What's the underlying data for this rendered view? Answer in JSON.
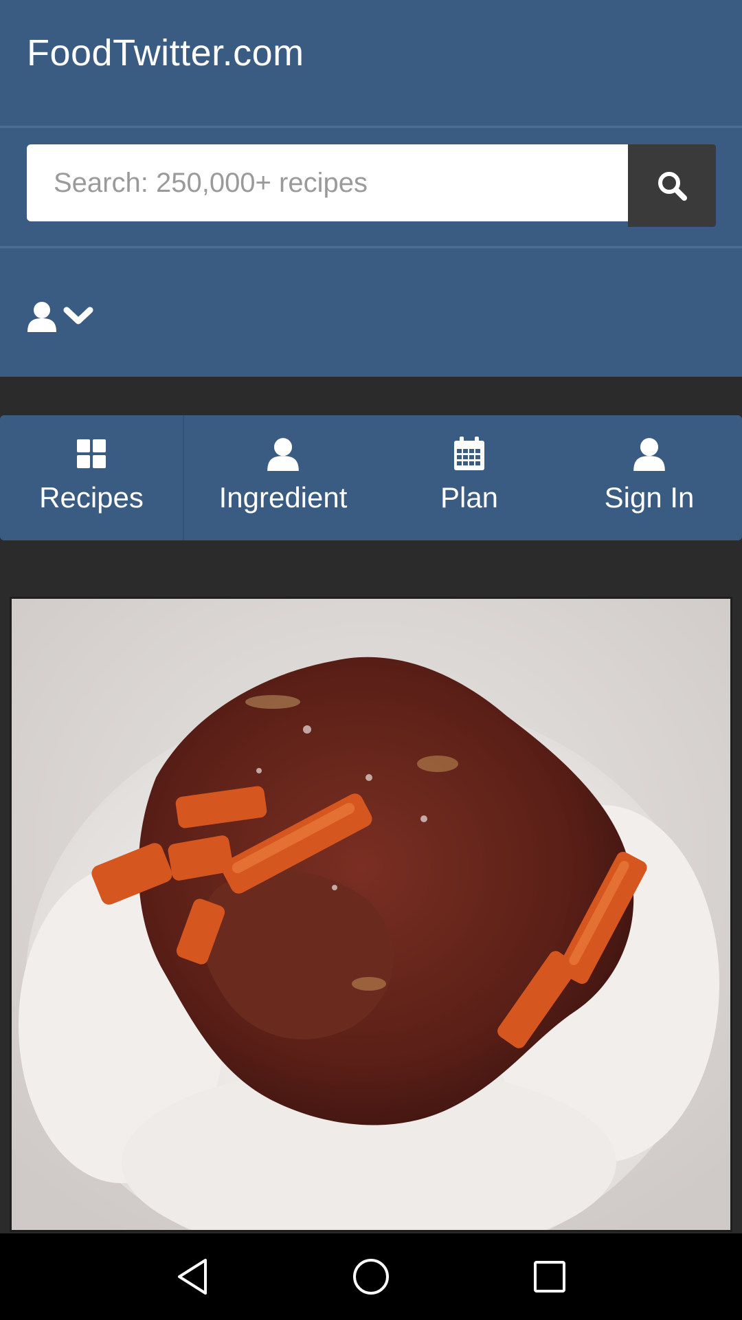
{
  "header": {
    "site_title": "FoodTwitter.com",
    "background_color": "#3b5c82"
  },
  "search": {
    "placeholder": "Search: 250,000+ recipes",
    "value": "",
    "button_icon": "search-icon"
  },
  "user_menu": {
    "icon": "user-icon",
    "dropdown_icon": "chevron-down-icon"
  },
  "nav": {
    "items": [
      {
        "label": "Recipes",
        "icon": "grid-icon"
      },
      {
        "label": "Ingredient",
        "icon": "user-icon"
      },
      {
        "label": "Plan",
        "icon": "calendar-icon"
      },
      {
        "label": "Sign In",
        "icon": "user-icon"
      }
    ]
  },
  "main": {
    "food_image": {
      "subject": "food-photo-icon"
    }
  },
  "system_nav": {
    "back": "back-icon",
    "home": "home-icon",
    "recents": "recents-icon"
  }
}
